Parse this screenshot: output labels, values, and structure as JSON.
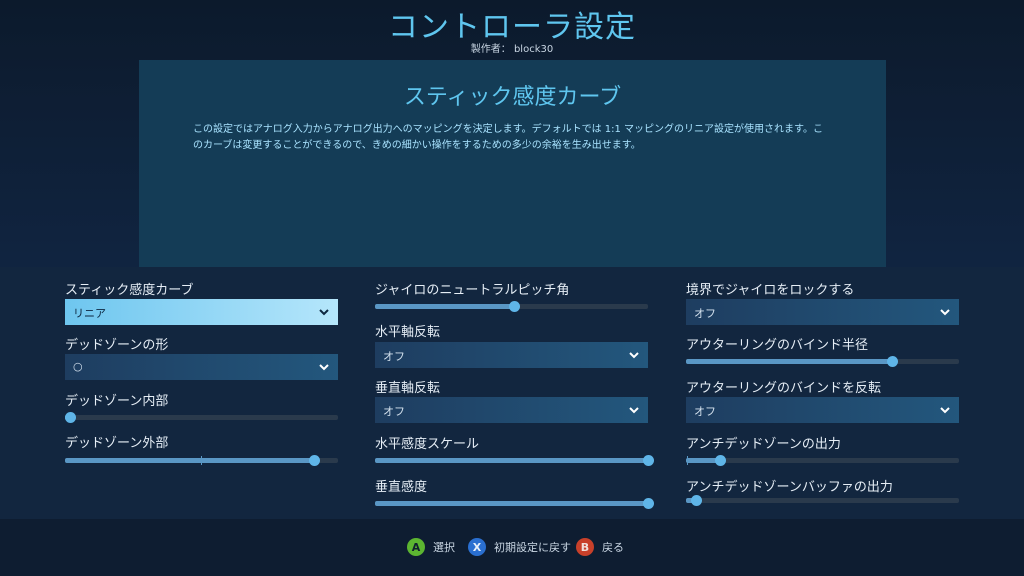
{
  "header": {
    "title": "コントローラ設定",
    "author": "製作者： block30"
  },
  "info": {
    "title": "スティック感度カーブ",
    "description": "この設定ではアナログ入力からアナログ出力へのマッピングを決定します。デフォルトでは 1:1 マッピングのリニア設定が使用されます。このカーブは変更することができるので、きめの細かい操作をするための多少の余裕を生み出せます。"
  },
  "columns": {
    "left": {
      "curve_label": "スティック感度カーブ",
      "curve_value": "リニア",
      "deadzone_shape_label": "デッドゾーンの形",
      "deadzone_shape_value": "○",
      "deadzone_inner_label": "デッドゾーン内部",
      "deadzone_inner_level": 0,
      "deadzone_outer_label": "デッドゾーン外部",
      "deadzone_outer_level": 0.91
    },
    "middle": {
      "pitch_label": "ジャイロのニュートラルピッチ角",
      "pitch_level": 0.5,
      "h_invert_label": "水平軸反転",
      "h_invert_value": "オフ",
      "v_invert_label": "垂直軸反転",
      "v_invert_value": "オフ",
      "h_scale_label": "水平感度スケール",
      "h_scale_level": 1.0,
      "v_sens_label": "垂直感度",
      "v_sens_level": 1.0
    },
    "right": {
      "lock_label": "境界でジャイロをロックする",
      "lock_value": "オフ",
      "outer_radius_label": "アウターリングのバインド半径",
      "outer_radius_level": 0.75,
      "outer_invert_label": "アウターリングのバインドを反転",
      "outer_invert_value": "オフ",
      "anti_dz_label": "アンチデッドゾーンの出力",
      "anti_dz_level": 0.11,
      "anti_dz_buffer_label": "アンチデッドゾーンバッファの出力",
      "anti_dz_buffer_level": 0.02
    }
  },
  "footer": {
    "select_key": "A",
    "select_label": "選択",
    "reset_key": "X",
    "reset_label": "初期設定に戻す",
    "back_key": "B",
    "back_label": "戻る"
  },
  "colors": {
    "accent": "#5fc6ef",
    "button_a": "#5cb531",
    "button_x": "#2a6fd0",
    "button_b": "#c8402a"
  }
}
